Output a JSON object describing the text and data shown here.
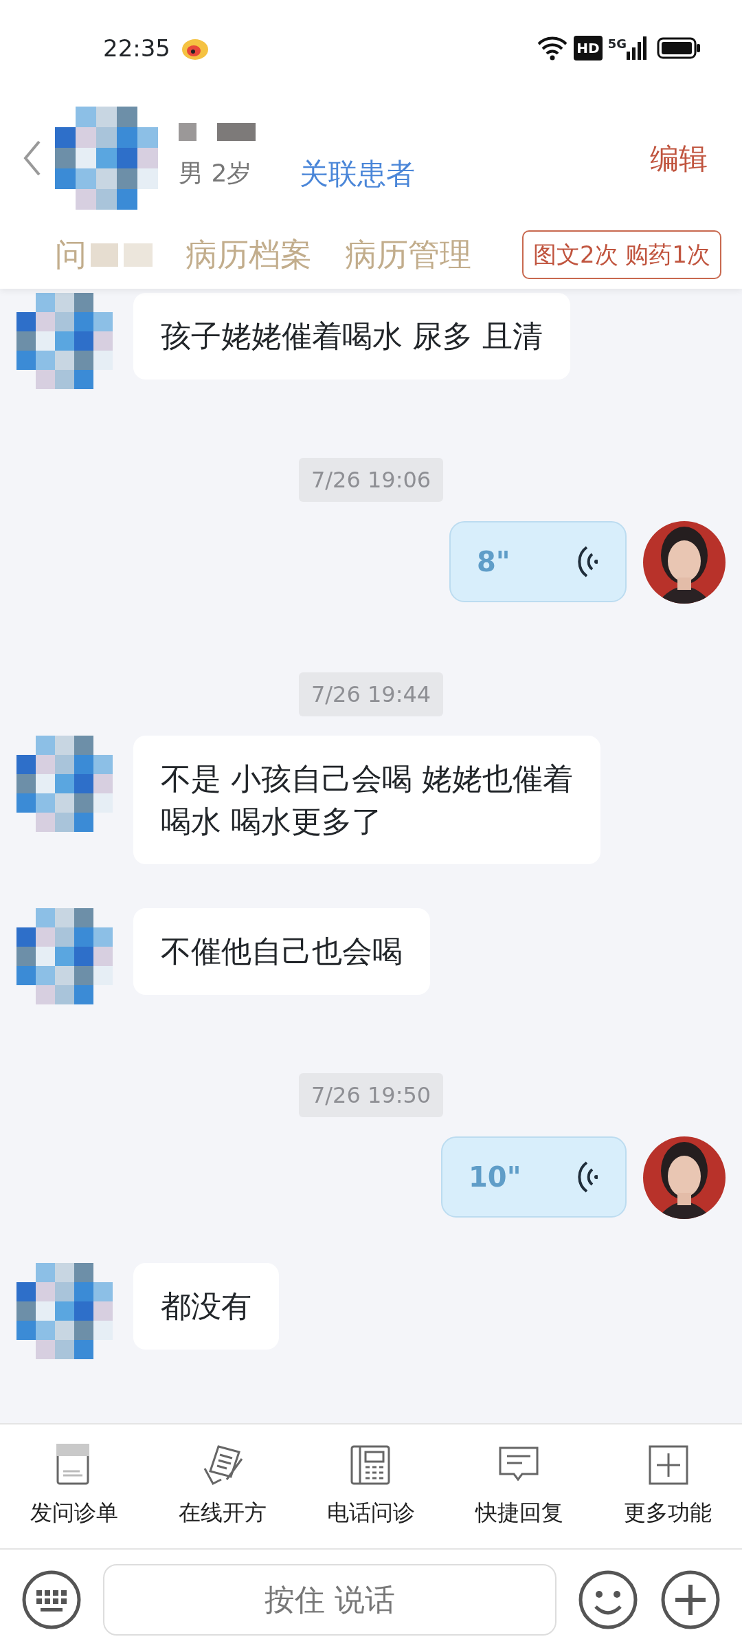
{
  "status_bar": {
    "time": "22:35",
    "hd": "HD",
    "network": "5G"
  },
  "patient": {
    "gender_age": "男 2岁",
    "link": "关联患者",
    "edit": "编辑"
  },
  "tabs": [
    {
      "label": "问"
    },
    {
      "label": "病历档案"
    },
    {
      "label": "病历管理"
    }
  ],
  "usage_badge": "图文2次 购药1次",
  "messages": [
    {
      "kind": "text",
      "text": "孩子姥姥催着喝水 尿多 且清"
    },
    {
      "kind": "time",
      "text": "7/26 19:06"
    },
    {
      "kind": "voice",
      "text": "8\""
    },
    {
      "kind": "time",
      "text": "7/26 19:44"
    },
    {
      "kind": "text",
      "text": "不是 小孩自己会喝 姥姥也催着喝水 喝水更多了"
    },
    {
      "kind": "text",
      "text": "不催他自己也会喝"
    },
    {
      "kind": "time",
      "text": "7/26 19:50"
    },
    {
      "kind": "voice",
      "text": "10\""
    },
    {
      "kind": "text",
      "text": "都没有"
    }
  ],
  "toolbar": [
    {
      "label": "发问诊单"
    },
    {
      "label": "在线开方"
    },
    {
      "label": "电话问诊"
    },
    {
      "label": "快捷回复"
    },
    {
      "label": "更多功能"
    }
  ],
  "input": {
    "hold_to_talk": "按住 说话"
  }
}
